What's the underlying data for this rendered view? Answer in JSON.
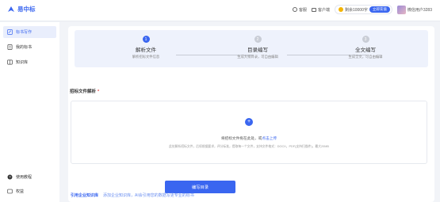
{
  "app": {
    "title": "易中标"
  },
  "header": {
    "service_label": "客服",
    "client_label": "客户端",
    "balance_text": "剩余10000字",
    "recharge_label": "立即充值",
    "user_name": "微信用户3283"
  },
  "sidebar": {
    "items": [
      {
        "label": "标书写作",
        "icon": "edit-doc-icon"
      },
      {
        "label": "我的标书",
        "icon": "document-icon"
      },
      {
        "label": "知识库",
        "icon": "book-icon"
      }
    ],
    "bottom_items": [
      {
        "label": "使用教程",
        "icon": "help-icon"
      },
      {
        "label": "权益",
        "icon": "benefit-icon"
      }
    ]
  },
  "steps": [
    {
      "number": "1",
      "title": "解析文件",
      "subtitle": "解析招标文件信息",
      "active": true
    },
    {
      "number": "2",
      "title": "目录编写",
      "subtitle": "生成大纲目录，可自由编辑",
      "active": false
    },
    {
      "number": "3",
      "title": "全文编写",
      "subtitle": "生成全文，可自由编辑",
      "active": false
    }
  ],
  "upload_section": {
    "title": "招标文件解析",
    "required_mark": "*",
    "prompt": "将招标文件拖在此处，或",
    "link_text": "点击上传",
    "hint": "此处解析招标文件，后续根据要求，评分标准，提取每一个文件，支持文件格式：DOCX，PDF(支持扫描件)，最大20MB"
  },
  "actions": {
    "primary_label": "编写目录"
  },
  "footer": {
    "kb_label": "引用企业知识库",
    "kb_hint": "添加企业知识库，AI会引用您的数据写更专业的标书"
  },
  "colors": {
    "accent": "#3a66f0",
    "inactive_step": "#c9cdd6",
    "required": "#e54545"
  }
}
